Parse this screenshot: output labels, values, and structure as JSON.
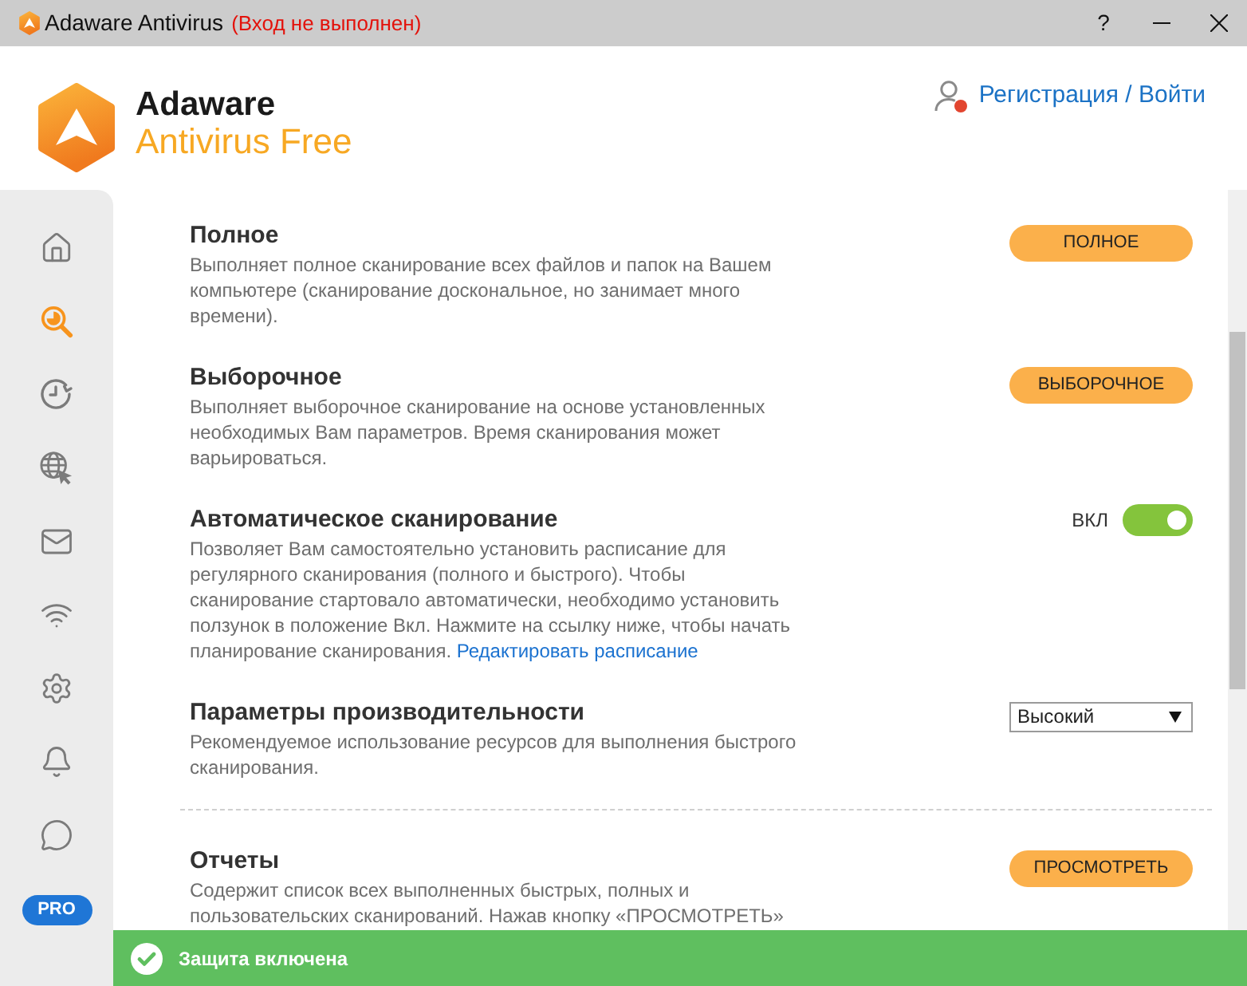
{
  "window": {
    "title": "Adaware Antivirus",
    "login_status": "(Вход не выполнен)",
    "help": "?"
  },
  "header": {
    "brand": "Adaware",
    "product": "Antivirus Free",
    "account_link": "Регистрация / Войти"
  },
  "sidebar": {
    "items": [
      {
        "selected": false
      },
      {
        "selected": true
      },
      {
        "selected": false
      },
      {
        "selected": false
      },
      {
        "selected": false
      },
      {
        "selected": false
      },
      {
        "selected": false
      },
      {
        "selected": false
      },
      {
        "selected": false
      }
    ],
    "pro_badge": "PRO"
  },
  "sections": [
    {
      "kind": "button",
      "title": "Полное",
      "description": "Выполняет полное сканирование всех файлов и папок на Вашем компьютере (сканирование доскональное, но занимает много времени).",
      "button": "ПОЛНОЕ",
      "divider_above": false
    },
    {
      "kind": "button",
      "title": "Выборочное",
      "description": "Выполняет выборочное сканирование на основе установленных необходимых Вам параметров. Время сканирования может варьироваться.",
      "button": "ВЫБОРОЧНОЕ",
      "divider_above": false
    },
    {
      "kind": "toggle",
      "title": "Автоматическое сканирование",
      "description": "Позволяет Вам самостоятельно установить расписание для регулярного сканирования (полного и быстрого). Чтобы сканирование стартовало автоматически, необходимо установить ползунок в положение Вкл. Нажмите на ссылку ниже, чтобы начать планирование сканирования.",
      "link": "Редактировать расписание",
      "toggle_label": "ВКЛ",
      "on": true,
      "divider_above": false
    },
    {
      "kind": "select",
      "title": "Параметры производительности",
      "description": "Рекомендуемое использование ресурсов для выполнения быстрого сканирования.",
      "value": "Высокий",
      "divider_above": false
    },
    {
      "kind": "button",
      "title": "Отчеты",
      "description": "Содержит список всех выполненных быстрых, полных и пользовательских сканирований. Нажав кнопку «ПРОСМОТРЕТЬ»",
      "button": "ПРОСМОТРЕТЬ",
      "divider_above": true
    }
  ],
  "status_bar": {
    "text": "Защита включена",
    "protected": true
  }
}
